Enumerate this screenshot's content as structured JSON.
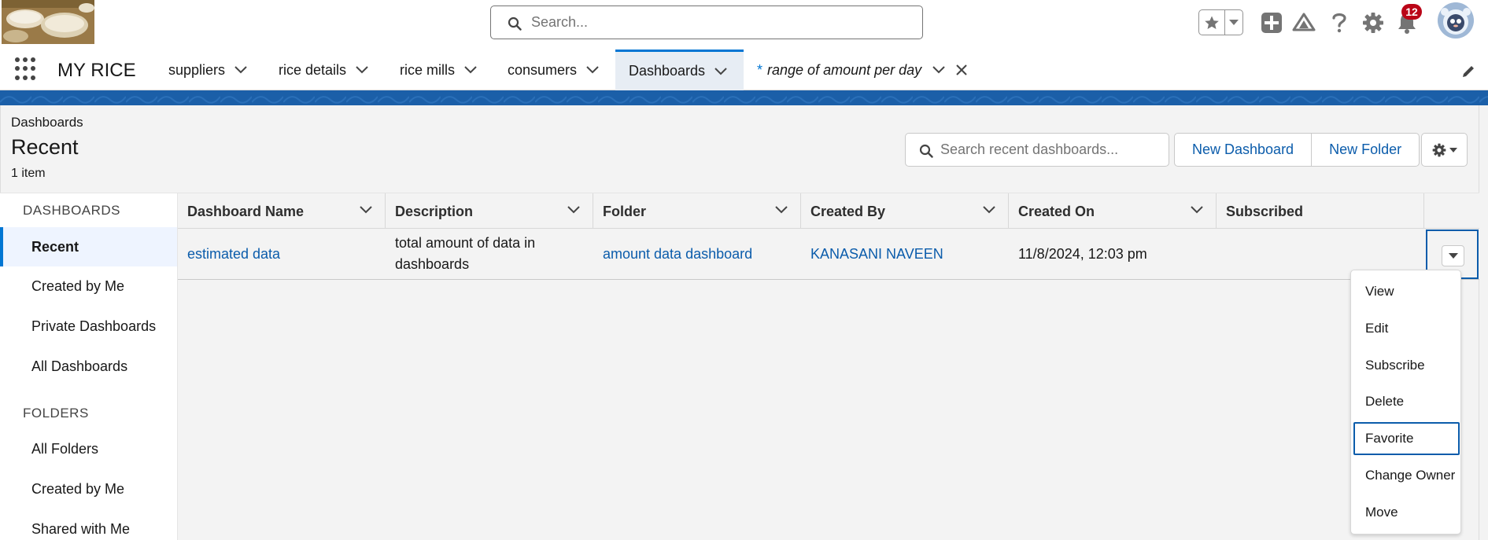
{
  "header": {
    "search_placeholder": "Search...",
    "notification_count": "12"
  },
  "nav": {
    "app_name": "MY RICE",
    "tabs": [
      {
        "label": "suppliers"
      },
      {
        "label": "rice details"
      },
      {
        "label": "rice mills"
      },
      {
        "label": "consumers"
      },
      {
        "label": "Dashboards"
      },
      {
        "label": "range of amount per day",
        "prefix": "*"
      }
    ]
  },
  "page": {
    "breadcrumb": "Dashboards",
    "title": "Recent",
    "item_count": "1 item",
    "search_placeholder": "Search recent dashboards...",
    "new_dashboard_label": "New Dashboard",
    "new_folder_label": "New Folder"
  },
  "sidebar": {
    "dashboards_heading": "DASHBOARDS",
    "dashboard_items": [
      "Recent",
      "Created by Me",
      "Private Dashboards",
      "All Dashboards"
    ],
    "folders_heading": "FOLDERS",
    "folder_items": [
      "All Folders",
      "Created by Me",
      "Shared with Me"
    ]
  },
  "table": {
    "columns": [
      "Dashboard Name",
      "Description",
      "Folder",
      "Created By",
      "Created On",
      "Subscribed"
    ],
    "rows": [
      {
        "name": "estimated data",
        "description": "total amount of data in dashboards",
        "folder": "amount data dashboard",
        "created_by": "KANASANI NAVEEN",
        "created_on": "11/8/2024, 12:03 pm",
        "subscribed": ""
      }
    ]
  },
  "row_menu": {
    "items": [
      "View",
      "Edit",
      "Subscribe",
      "Delete",
      "Favorite",
      "Change Owner",
      "Move"
    ],
    "focused": "Favorite"
  },
  "colors": {
    "brand_blue": "#0176d3",
    "link_blue": "#0b5cab",
    "band_blue": "#1b5fa8",
    "badge_red": "#ba0517"
  }
}
